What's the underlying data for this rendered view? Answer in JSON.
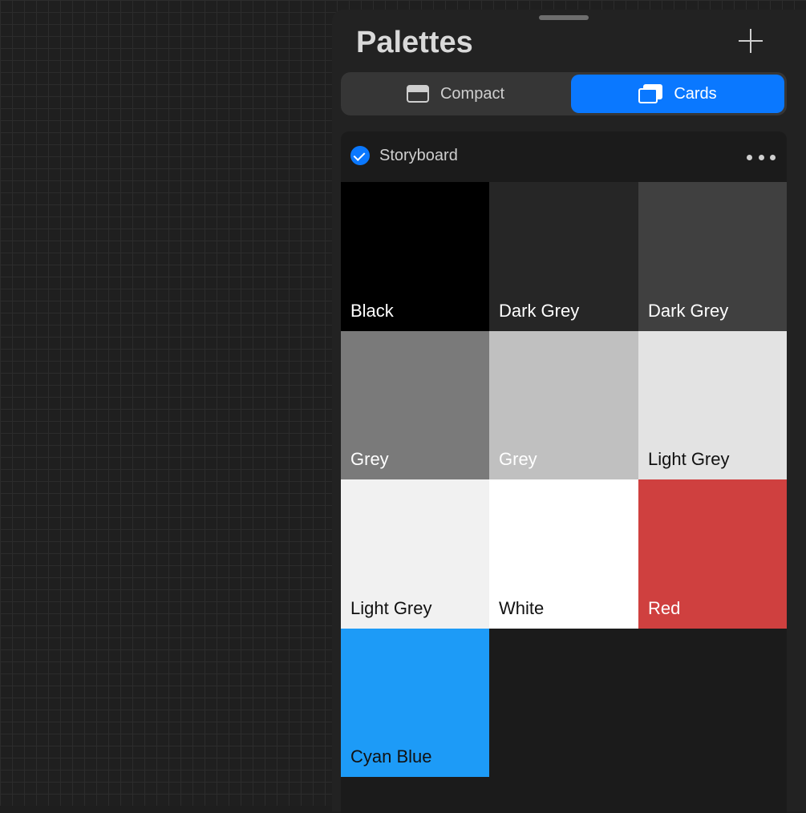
{
  "panel": {
    "title": "Palettes",
    "view_modes": [
      {
        "label": "Compact",
        "icon": "compact-view-icon",
        "selected": false
      },
      {
        "label": "Cards",
        "icon": "cards-view-icon",
        "selected": true
      }
    ]
  },
  "palette": {
    "name": "Storyboard",
    "is_default": true,
    "swatches": [
      {
        "label": "Black",
        "color": "#000000",
        "text_color": "#ffffff"
      },
      {
        "label": "Dark Grey",
        "color": "#262626",
        "text_color": "#ffffff"
      },
      {
        "label": "Dark Grey",
        "color": "#404040",
        "text_color": "#ffffff"
      },
      {
        "label": "Grey",
        "color": "#7a7a7a",
        "text_color": "#ffffff"
      },
      {
        "label": "Grey",
        "color": "#c0c0c0",
        "text_color": "#ffffff"
      },
      {
        "label": "Light Grey",
        "color": "#e3e3e3",
        "text_color": "#111111"
      },
      {
        "label": "Light Grey",
        "color": "#f1f1f1",
        "text_color": "#111111"
      },
      {
        "label": "White",
        "color": "#ffffff",
        "text_color": "#111111"
      },
      {
        "label": "Red",
        "color": "#cf403f",
        "text_color": "#ffffff"
      },
      {
        "label": "Cyan Blue",
        "color": "#1d9bf7",
        "text_color": "#111111"
      }
    ]
  },
  "colors": {
    "accent": "#0a78ff",
    "panel_bg": "#222222",
    "canvas_bg": "#1f1f1f"
  }
}
